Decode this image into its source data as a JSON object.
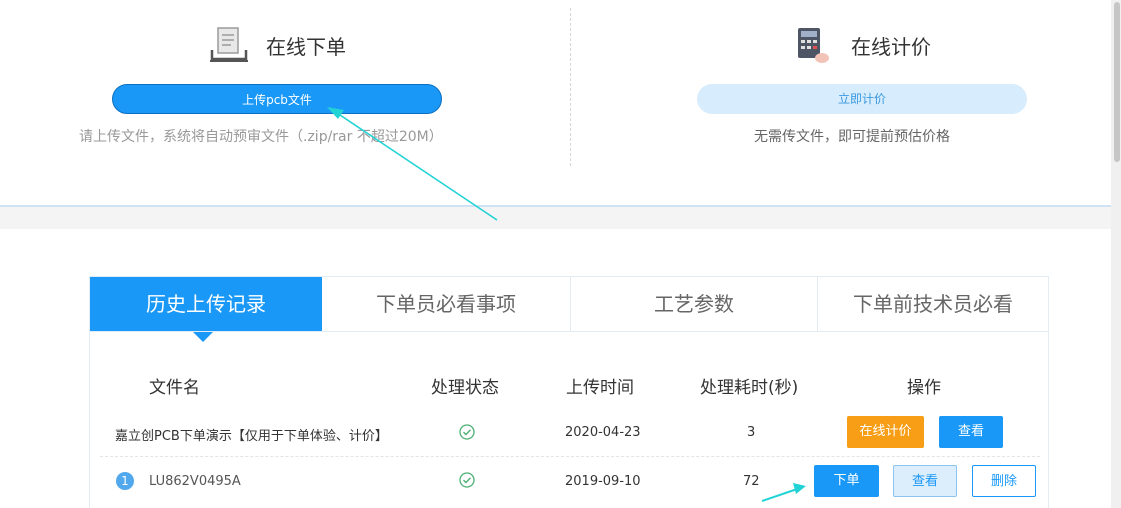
{
  "order_section": {
    "title": "在线下单",
    "button_label": "上传pcb文件",
    "hint": "请上传文件，系统将自动预审文件（.zip/rar 不超过20M）"
  },
  "price_section": {
    "title": "在线计价",
    "button_label": "立即计价",
    "hint": "无需传文件，即可提前预估价格"
  },
  "tabs": [
    {
      "label": "历史上传记录"
    },
    {
      "label": "下单员必看事项"
    },
    {
      "label": "工艺参数"
    },
    {
      "label": "下单前技术员必看"
    }
  ],
  "table": {
    "headers": [
      "文件名",
      "处理状态",
      "上传时间",
      "处理耗时(秒)",
      "操作"
    ],
    "rows": [
      {
        "file_name": "嘉立创PCB下单演示【仅用于下单体验、计价】",
        "status_icon": "check-circle-icon",
        "upload_time": "2020-04-23",
        "duration": "3",
        "actions": [
          "在线计价",
          "查看"
        ]
      },
      {
        "index": "1",
        "file_name": "LU862V0495A",
        "status_icon": "check-circle-icon",
        "upload_time": "2019-09-10",
        "duration": "72",
        "actions": [
          "下单",
          "查看",
          "删除"
        ]
      }
    ]
  },
  "colors": {
    "primary": "#1a98f8",
    "orange": "#f79d16",
    "success": "#4caf72",
    "annotation_arrow": "#22d3d6"
  },
  "icons": {
    "order": "document-tray-icon",
    "price": "calculator-icon"
  }
}
